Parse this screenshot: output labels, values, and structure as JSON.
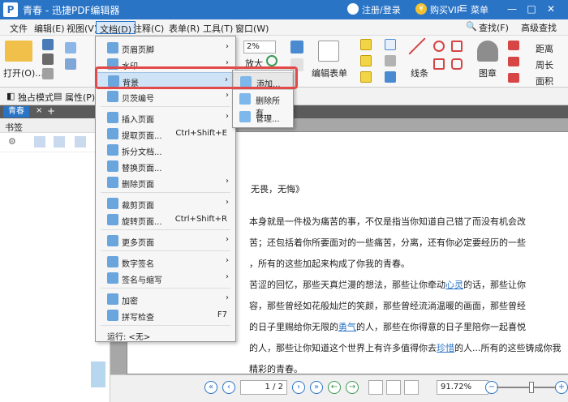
{
  "titlebar": {
    "logo": "P",
    "title": "青春 - 迅捷PDF编辑器",
    "user": "注册/登录",
    "vip": "购买VIP",
    "menu": "菜单",
    "min": "—",
    "max": "□",
    "close": "✕"
  },
  "menubar": {
    "items": [
      "文件",
      "编辑(E)",
      "视图(V)",
      "文档(D)",
      "注释(C)",
      "表单(R)",
      "工具(T)",
      "窗口(W)"
    ],
    "right": [
      "查找(F)",
      "高级查找"
    ]
  },
  "ribbon": {
    "open": "打开(O)...",
    "zoom_percent": "2%",
    "zoom_label": "放大",
    "edit_form": "编辑表单",
    "line": "线条",
    "stamp": "图章",
    "distance": "距离",
    "perimeter": "周长",
    "area": "面积"
  },
  "subbar": {
    "standalone": "独占模式",
    "properties": "属性(P)..."
  },
  "tabs": {
    "active": "青春",
    "close": "×",
    "add": "+"
  },
  "sidepanel": {
    "title": "书签"
  },
  "document": {
    "title_text": "无畏，无悔》",
    "lines": [
      "本身就是一件极为痛苦的事，不仅是指当你知道自己错了而没有机会改",
      "苦；还包括着你所要面对的一些痛苦，分离，还有你必定要经历的一些",
      "，所有的这些加起来构成了你我的青春。",
      "苦涩的回忆，那些天真烂漫的想法，那些让你牵动",
      "心灵",
      "的话，那些让你",
      "容，那些曾经如花般灿烂的笑颜，那些曾经流淌温暖的画面，那些曾经",
      "的日子里赐给你无限的",
      "勇气",
      "的人，那些在你得意的日子里陪你一起喜悦",
      "的人，那些让你知道这个世界上有许多值得你去",
      "珍惜",
      "的人...所有的这些铸成你我",
      "精彩的青春。"
    ]
  },
  "bottombar": {
    "page": "1",
    "total": "/ 2",
    "zoom": "91.72%"
  },
  "doc_menu": {
    "items": [
      {
        "label": "页眉页脚",
        "shortcut": "",
        "arrow": "›"
      },
      {
        "label": "水印",
        "shortcut": "",
        "arrow": "›"
      },
      {
        "label": "背景",
        "shortcut": "",
        "arrow": "›"
      },
      {
        "label": "贝茨编号",
        "shortcut": "",
        "arrow": "›"
      },
      {
        "label": "插入页面",
        "shortcut": "",
        "arrow": "›"
      },
      {
        "label": "提取页面...",
        "shortcut": "Ctrl+Shift+E",
        "arrow": ""
      },
      {
        "label": "拆分文档...",
        "shortcut": "",
        "arrow": ""
      },
      {
        "label": "替换页面...",
        "shortcut": "",
        "arrow": ""
      },
      {
        "label": "删除页面",
        "shortcut": "",
        "arrow": "›"
      },
      {
        "label": "裁剪页面",
        "shortcut": "",
        "arrow": "›"
      },
      {
        "label": "旋转页面...",
        "shortcut": "Ctrl+Shift+R",
        "arrow": ""
      },
      {
        "label": "更多页面",
        "shortcut": "",
        "arrow": "›"
      },
      {
        "label": "数字签名",
        "shortcut": "",
        "arrow": "›"
      },
      {
        "label": "签名与缩写",
        "shortcut": "",
        "arrow": "›"
      },
      {
        "label": "加密",
        "shortcut": "",
        "arrow": "›"
      },
      {
        "label": "拼写检查",
        "shortcut": "F7",
        "arrow": ""
      },
      {
        "label": "运行: <无>",
        "shortcut": "",
        "arrow": ""
      }
    ]
  },
  "submenu": {
    "items": [
      "添加...",
      "删除所有...",
      "管理..."
    ]
  },
  "colors": {
    "brand": "#2a74c6",
    "highlight": "#e24a4a"
  }
}
